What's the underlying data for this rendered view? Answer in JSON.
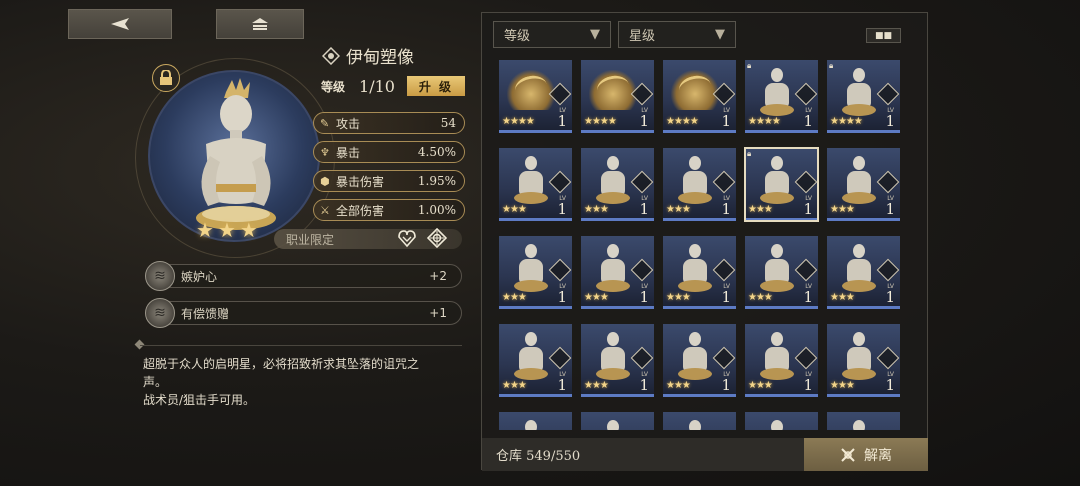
{
  "nav": {
    "back_icon": "back-arrow-icon",
    "home_icon": "home-icon"
  },
  "item": {
    "name": "伊甸塑像",
    "level_label": "等级",
    "level_value": "1/10",
    "upgrade_label": "升 级",
    "stars": [
      "★",
      "★",
      "★"
    ]
  },
  "stats": [
    {
      "icon": "sword-icon",
      "label": "攻击",
      "value": "54"
    },
    {
      "icon": "chalice-icon",
      "label": "暴击",
      "value": "4.50%"
    },
    {
      "icon": "shield-crit-icon",
      "label": "暴击伤害",
      "value": "1.95%"
    },
    {
      "icon": "blade-icon",
      "label": "全部伤害",
      "value": "1.00%"
    }
  ],
  "class_limit": {
    "label": "职业限定"
  },
  "skills": [
    {
      "label": "嫉妒心",
      "value": "+2"
    },
    {
      "label": "有偿馈赠",
      "value": "+1"
    }
  ],
  "description": {
    "line1": "超脱于众人的启明星，必将招致祈求其坠落的诅咒之",
    "line2": "声。",
    "line3": "战术员/狙击手可用。"
  },
  "filters": {
    "level": "等级",
    "star": "星级"
  },
  "inventory": {
    "lv_tag": "LV",
    "cards": [
      {
        "type": "wings",
        "lv": "1",
        "stars": "★★★★",
        "locked": false,
        "selected": false
      },
      {
        "type": "wings",
        "lv": "1",
        "stars": "★★★★",
        "locked": false,
        "selected": false
      },
      {
        "type": "wings",
        "lv": "1",
        "stars": "★★★★",
        "locked": false,
        "selected": false
      },
      {
        "type": "statue",
        "lv": "1",
        "stars": "★★★★",
        "locked": true,
        "selected": false
      },
      {
        "type": "statue",
        "lv": "1",
        "stars": "★★★★",
        "locked": true,
        "selected": false
      },
      {
        "type": "statue",
        "lv": "1",
        "stars": "★★★",
        "locked": false,
        "selected": false
      },
      {
        "type": "statue",
        "lv": "1",
        "stars": "★★★",
        "locked": false,
        "selected": false
      },
      {
        "type": "statue",
        "lv": "1",
        "stars": "★★★",
        "locked": false,
        "selected": false
      },
      {
        "type": "statue",
        "lv": "1",
        "stars": "★★★",
        "locked": true,
        "selected": true
      },
      {
        "type": "statue",
        "lv": "1",
        "stars": "★★★",
        "locked": false,
        "selected": false
      },
      {
        "type": "statue",
        "lv": "1",
        "stars": "★★★",
        "locked": false,
        "selected": false
      },
      {
        "type": "statue",
        "lv": "1",
        "stars": "★★★",
        "locked": false,
        "selected": false
      },
      {
        "type": "statue",
        "lv": "1",
        "stars": "★★★",
        "locked": false,
        "selected": false
      },
      {
        "type": "statue",
        "lv": "1",
        "stars": "★★★",
        "locked": false,
        "selected": false
      },
      {
        "type": "statue",
        "lv": "1",
        "stars": "★★★",
        "locked": false,
        "selected": false
      },
      {
        "type": "statue",
        "lv": "1",
        "stars": "★★★",
        "locked": false,
        "selected": false
      },
      {
        "type": "statue",
        "lv": "1",
        "stars": "★★★",
        "locked": false,
        "selected": false
      },
      {
        "type": "statue",
        "lv": "1",
        "stars": "★★★",
        "locked": false,
        "selected": false
      },
      {
        "type": "statue",
        "lv": "1",
        "stars": "★★★",
        "locked": false,
        "selected": false
      },
      {
        "type": "statue",
        "lv": "1",
        "stars": "★★★",
        "locked": false,
        "selected": false
      },
      {
        "type": "statue",
        "lv": "",
        "stars": "",
        "locked": false,
        "selected": false
      },
      {
        "type": "statue",
        "lv": "",
        "stars": "",
        "locked": false,
        "selected": false
      },
      {
        "type": "statue",
        "lv": "",
        "stars": "",
        "locked": false,
        "selected": false
      },
      {
        "type": "statue",
        "lv": "",
        "stars": "",
        "locked": false,
        "selected": false
      },
      {
        "type": "statue",
        "lv": "",
        "stars": "",
        "locked": false,
        "selected": false
      }
    ]
  },
  "storage": {
    "text": "仓库 549/550"
  },
  "dismantle": {
    "label": "解离"
  }
}
